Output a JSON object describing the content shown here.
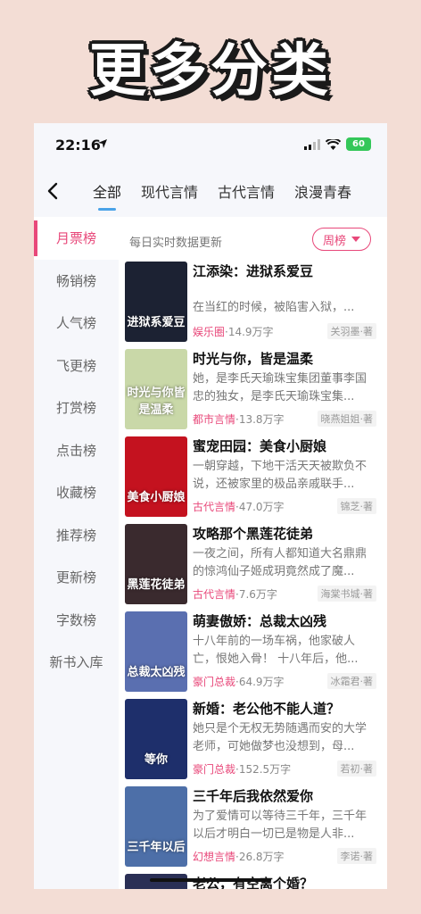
{
  "promo": {
    "title": "更多分类"
  },
  "status": {
    "time": "22:16",
    "battery": "60"
  },
  "nav": {
    "tabs": [
      {
        "label": "全部"
      },
      {
        "label": "现代言情"
      },
      {
        "label": "古代言情"
      },
      {
        "label": "浪漫青春"
      }
    ]
  },
  "sidebar": {
    "items": [
      {
        "label": "月票榜"
      },
      {
        "label": "畅销榜"
      },
      {
        "label": "人气榜"
      },
      {
        "label": "飞更榜"
      },
      {
        "label": "打赏榜"
      },
      {
        "label": "点击榜"
      },
      {
        "label": "收藏榜"
      },
      {
        "label": "推荐榜"
      },
      {
        "label": "更新榜"
      },
      {
        "label": "字数榜"
      },
      {
        "label": "新书入库"
      }
    ]
  },
  "list": {
    "subtitle": "每日实时数据更新",
    "sort_label": "周榜",
    "books": [
      {
        "title": "江添染：进狱系爱豆",
        "desc": "在当红的时候，被陷害入狱，...",
        "genre": "娱乐圈",
        "words": "·14.9万字",
        "author": "关羽墨·著",
        "cover_text": "进狱系爱豆",
        "cover_color": "#1c2233"
      },
      {
        "title": "时光与你，皆是温柔",
        "desc": "她，是李氏天瑜珠宝集团董事李国忠的独女，是李氏天瑜珠宝集...",
        "genre": "都市言情",
        "words": "·13.8万字",
        "author": "晓燕姐姐·著",
        "cover_text": "时光与你皆是温柔",
        "cover_color": "#c9d8a8"
      },
      {
        "title": "蜜宠田园：美食小厨娘",
        "desc": "一朝穿越，下地干活天天被欺负不说，还被家里的极品亲戚联手...",
        "genre": "古代言情",
        "words": "·47.0万字",
        "author": "锦芝·著",
        "cover_text": "美食小厨娘",
        "cover_color": "#c4121f"
      },
      {
        "title": "攻略那个黑莲花徒弟",
        "desc": "一夜之间，所有人都知道大名鼎鼎的惊鸿仙子姬成玥竟然成了魔...",
        "genre": "古代言情",
        "words": "·7.6万字",
        "author": "海棠书城·著",
        "cover_text": "黑莲花徒弟",
        "cover_color": "#3a2a2e"
      },
      {
        "title": "萌妻傲娇：总裁太凶残",
        "desc": "十八年前的一场车祸，他家破人亡，恨她入骨！ 十八年后，他...",
        "genre": "豪门总裁",
        "words": "·64.9万字",
        "author": "冰霜君·著",
        "cover_text": "总裁太凶残",
        "cover_color": "#5a6fb0"
      },
      {
        "title": "新婚：老公他不能人道？",
        "desc": "她只是个无权无势随遇而安的大学老师，可她做梦也没想到，母...",
        "genre": "豪门总裁",
        "words": "·152.5万字",
        "author": "若初·著",
        "cover_text": "等你",
        "cover_color": "#1e2f6b"
      },
      {
        "title": "三千年后我依然爱你",
        "desc": "为了爱情可以等待三千年，三千年以后才明白一切已是物是人非...",
        "genre": "幻想言情",
        "words": "·26.8万字",
        "author": "李诺·著",
        "cover_text": "三千年以后",
        "cover_color": "#4d6fa8"
      },
      {
        "title": "老公，有空离个婚？",
        "desc": "",
        "genre": "",
        "words": "",
        "author": "",
        "cover_text": "",
        "cover_color": "#2a2f55"
      }
    ]
  }
}
